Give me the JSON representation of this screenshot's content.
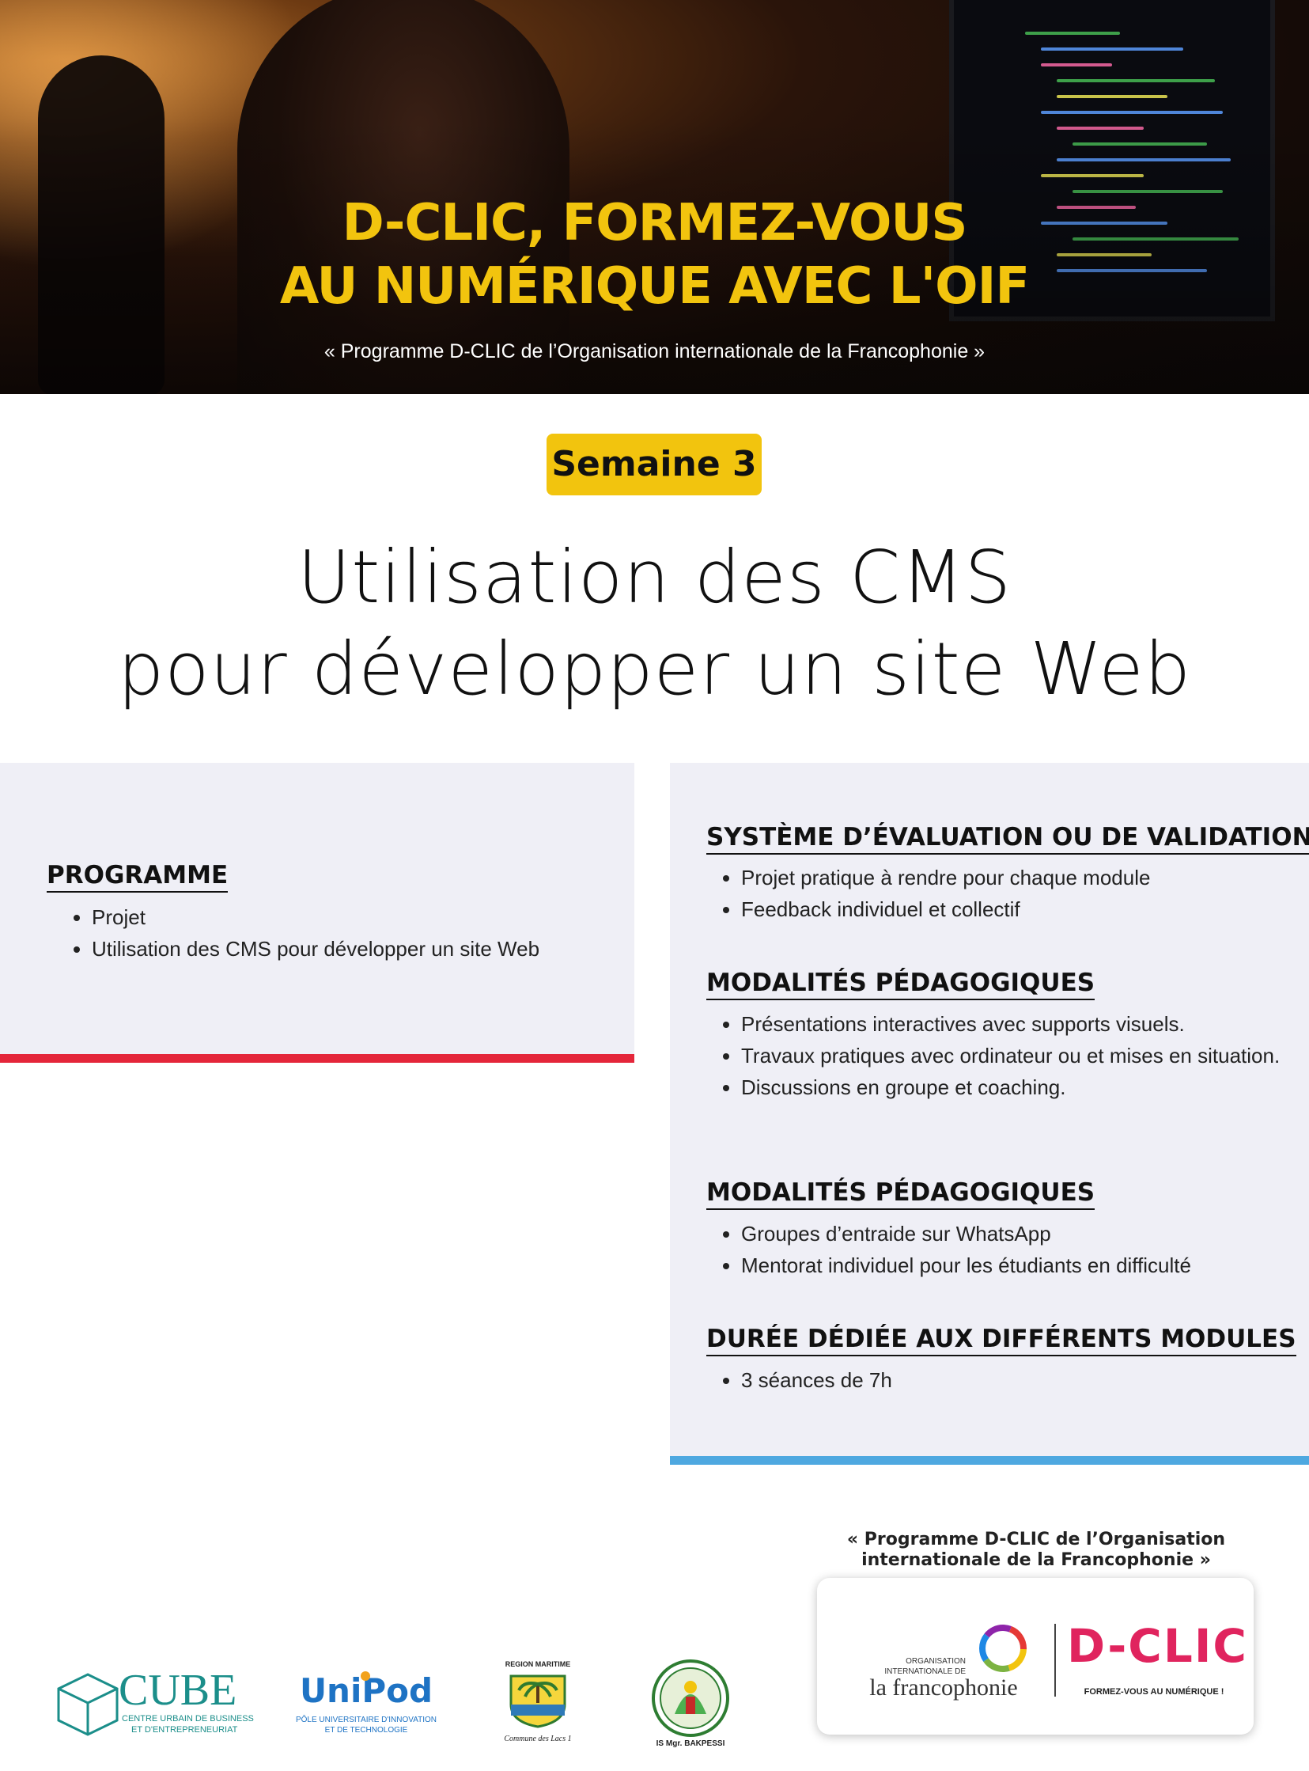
{
  "hero": {
    "title_line1": "D-CLIC, FORMEZ-VOUS",
    "title_line2": "AU NUMÉRIQUE AVEC L'OIF",
    "subtitle": "« Programme D-CLIC de l’Organisation internationale de la Francophonie »"
  },
  "badge": "Semaine 3",
  "title": {
    "line1": "Utilisation des CMS",
    "line2": "pour développer un site Web"
  },
  "programme": {
    "heading": "PROGRAMME",
    "items": [
      "Projet",
      "Utilisation des CMS pour développer un site Web"
    ]
  },
  "sections": [
    {
      "heading": "SYSTÈME D’ÉVALUATION OU DE VALIDATION",
      "items": [
        "Projet pratique à rendre pour chaque module",
        "Feedback individuel et collectif"
      ]
    },
    {
      "heading": "MODALITÉS PÉDAGOGIQUES",
      "items": [
        "Présentations  interactives avec supports visuels.",
        "Travaux  pratiques avec ordinateur ou et mises en situation.",
        "Discussions  en groupe et coaching."
      ]
    },
    {
      "heading": "MODALITÉS PÉDAGOGIQUES",
      "items": [
        "Groupes d’entraide sur WhatsApp",
        "Mentorat individuel pour les étudiants en difficulté"
      ]
    },
    {
      "heading": "DURÉE DÉDIÉE AUX DIFFÉRENTS MODULES",
      "items": [
        "3 séances de 7h"
      ]
    }
  ],
  "footer": {
    "quote": "« Programme D-CLIC de l’Organisation internationale de la Francophonie »",
    "logos": {
      "cube": {
        "name": "CUBE",
        "line1": "CENTRE URBAIN DE BUSINESS",
        "line2": "ET D'ENTREPRENEURIAT"
      },
      "unipod": {
        "name": "UniPod",
        "line1": "PÔLE UNIVERSITAIRE D'INNOVATION",
        "line2": "ET DE TECHNOLOGIE"
      },
      "region": {
        "top": "REGION MARITIME",
        "bottom": "Commune des Lacs 1"
      },
      "isbakpessi": {
        "name": "IS Mgr. BAKPESSI"
      },
      "oif": {
        "line1": "ORGANISATION",
        "line2": "INTERNATIONALE DE",
        "name": "la francophonie"
      },
      "dclic": {
        "name": "D-CLIC",
        "tagline": "FORMEZ-VOUS AU NUMÉRIQUE !"
      }
    }
  },
  "colors": {
    "yellow": "#f2c40e",
    "red": "#e4263a",
    "blue": "#4ea8e0",
    "panel": "#efeff6"
  }
}
